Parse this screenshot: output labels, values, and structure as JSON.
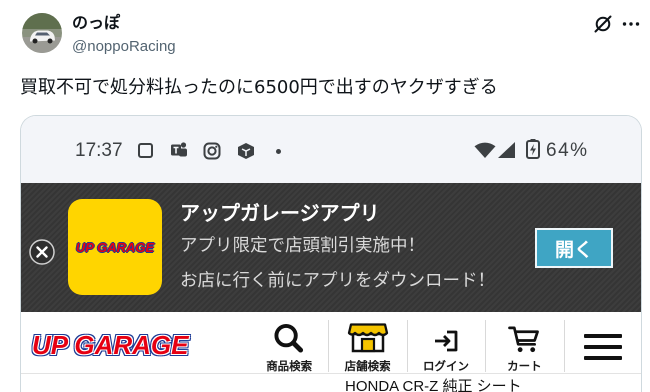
{
  "post": {
    "author": {
      "name": "のっぽ",
      "handle": "@noppoRacing"
    },
    "text": "買取不可で処分料払ったのに6500円で出すのヤクザすぎる",
    "icons": {
      "avatar": "avatar",
      "grok": "grok-icon",
      "more": "more-icon"
    }
  },
  "screenshot": {
    "status_bar": {
      "time": "17:37",
      "battery": "64%",
      "notification_icons": [
        "square-icon",
        "teams-icon",
        "instagram-icon",
        "gem-icon",
        "dot-icon"
      ],
      "system_icons": [
        "wifi-icon",
        "signal-icon",
        "battery-charging-icon"
      ]
    },
    "app_banner": {
      "logo_text": "UP GARAGE",
      "title": "アップガレージアプリ",
      "line1": "アプリ限定で店頭割引実施中！",
      "line2": "お店に行く前にアプリをダウンロード！",
      "open_button": "開く",
      "close_icon": "close-icon"
    },
    "site_header": {
      "logo_text": "UP GARAGE",
      "nav": [
        {
          "label": "商品検索",
          "icon": "search-icon"
        },
        {
          "label": "店舗検索",
          "icon": "store-icon"
        },
        {
          "label": "ログイン",
          "icon": "login-icon"
        },
        {
          "label": "カート",
          "icon": "cart-icon"
        }
      ],
      "menu_icon": "hamburger-icon"
    },
    "partial_text": "HONDA CR-Z 純正 シート"
  },
  "colors": {
    "text": "#0f1419",
    "secondary_text": "#536471",
    "status_bar_bg": "#f3f5f9",
    "banner_bg": "#3a3a3a",
    "logo_tile": "#ffd500",
    "open_button": "#3fa5c4",
    "logo_red": "#e60012",
    "logo_blue": "#1d3c96",
    "store_awning": "#f5c400"
  }
}
